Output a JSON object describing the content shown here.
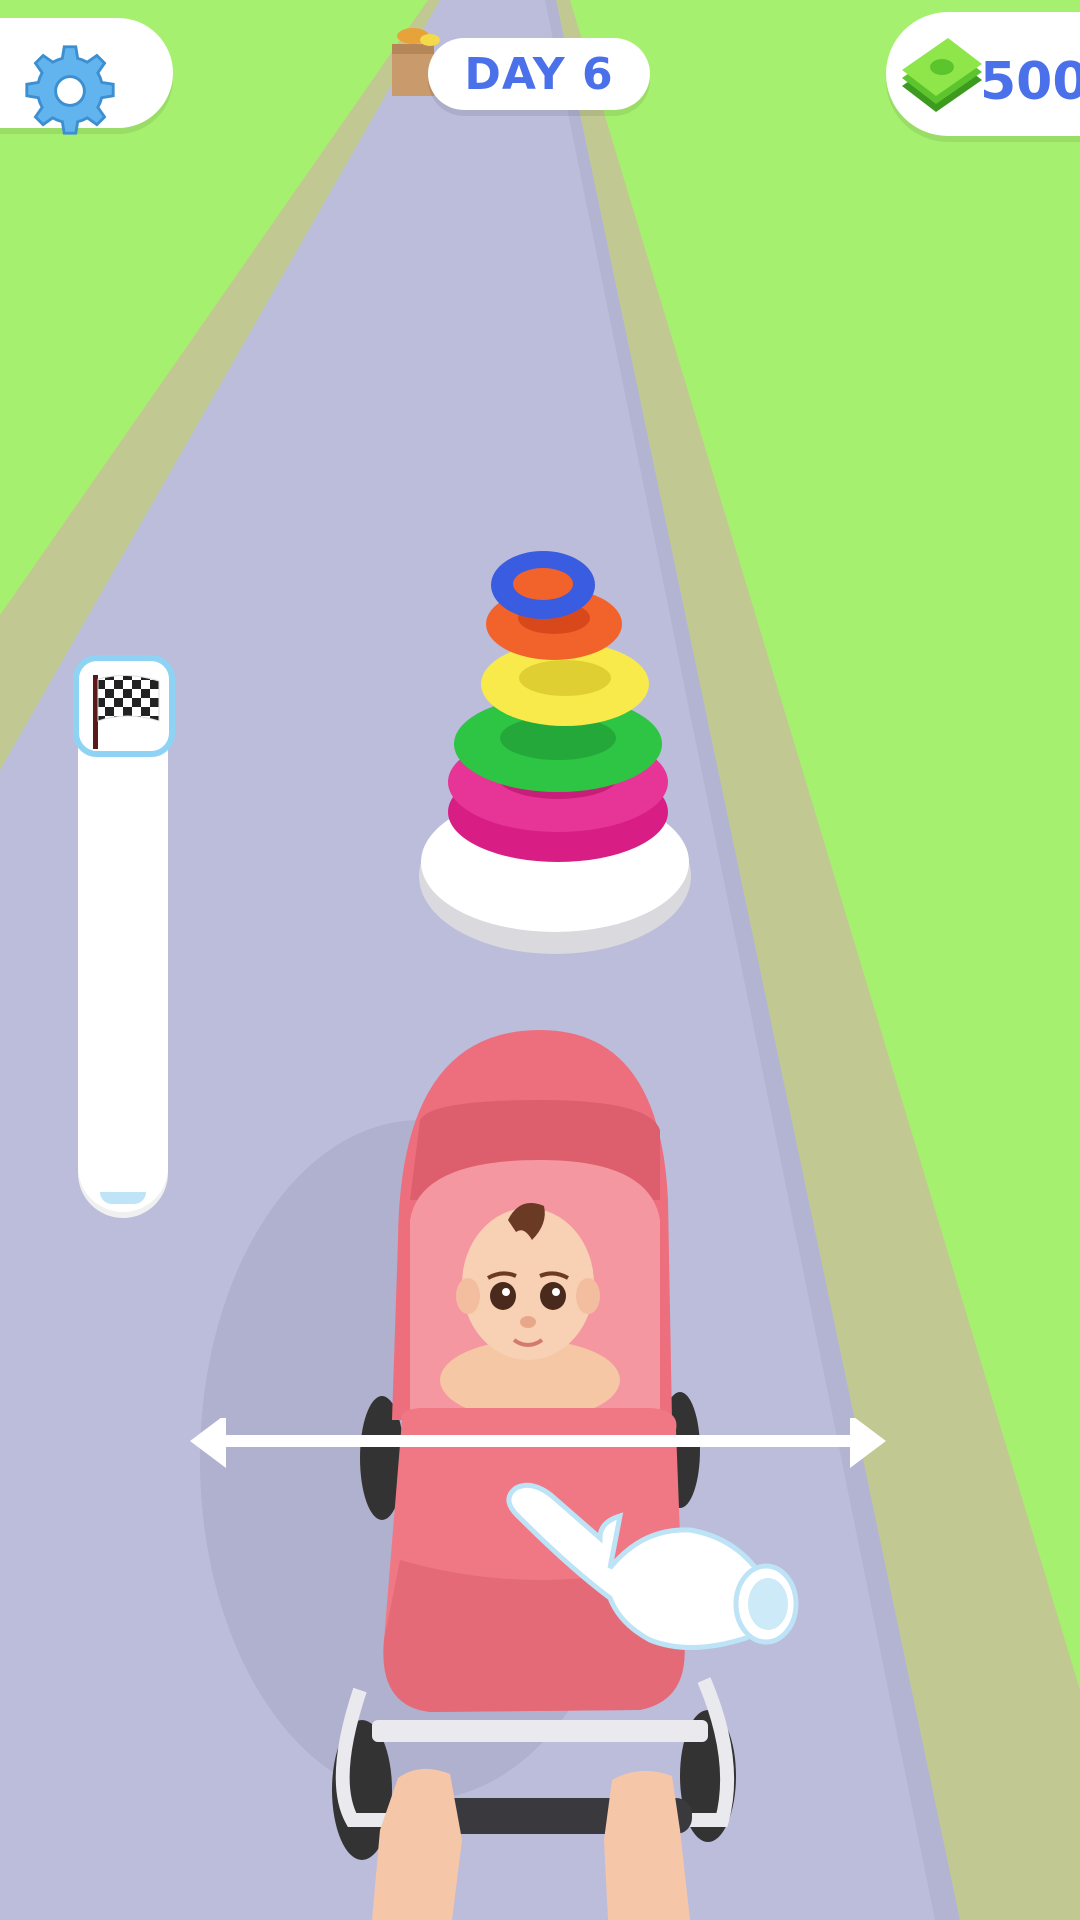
{
  "hud": {
    "settings_icon": "gear-icon",
    "day_label": "DAY 6",
    "cash_icon": "cash-stack-icon",
    "cash_amount": "500"
  },
  "progress": {
    "goal_icon": "checkered-flag-icon",
    "level_progress": 0.02
  },
  "tutorial": {
    "gesture": "swipe-left-right",
    "hint_icons": [
      "double-arrow-icon",
      "pointing-hand-icon"
    ]
  },
  "colors": {
    "grass": "#a6f06f",
    "road": "#bbbddb",
    "curb": "#c2c892",
    "ui_text": "#4a70ea",
    "stroller": "#f07884",
    "progress_border": "#8fd3f4"
  }
}
